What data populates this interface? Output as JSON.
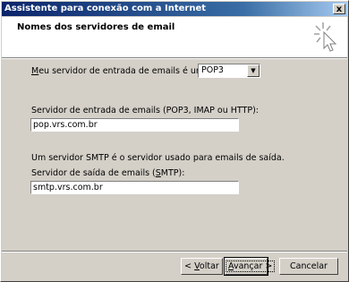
{
  "window": {
    "title": "Assistente para conexão com a Internet",
    "close_symbol": "x"
  },
  "header": {
    "title": "Nomes dos servidores de email"
  },
  "incoming_type": {
    "label_prefix": "",
    "label_hotkey": "M",
    "label_rest": "eu servidor de entrada de emails é um servidor",
    "selected": "POP3"
  },
  "incoming_server": {
    "label": "Servidor de entrada de emails (POP3, IMAP ou HTTP):",
    "value": "pop.vrs.com.br"
  },
  "smtp_note": "Um servidor SMTP é o servidor usado para emails de saída.",
  "outgoing_server": {
    "label_prefix": "Servidor de saída de emails (",
    "label_hotkey": "S",
    "label_rest": "MTP):",
    "value": "smtp.vrs.com.br"
  },
  "buttons": {
    "back_prefix": "< ",
    "back_hotkey": "V",
    "back_rest": "oltar",
    "next_hotkey": "A",
    "next_rest": "vançar >",
    "cancel": "Cancelar"
  }
}
